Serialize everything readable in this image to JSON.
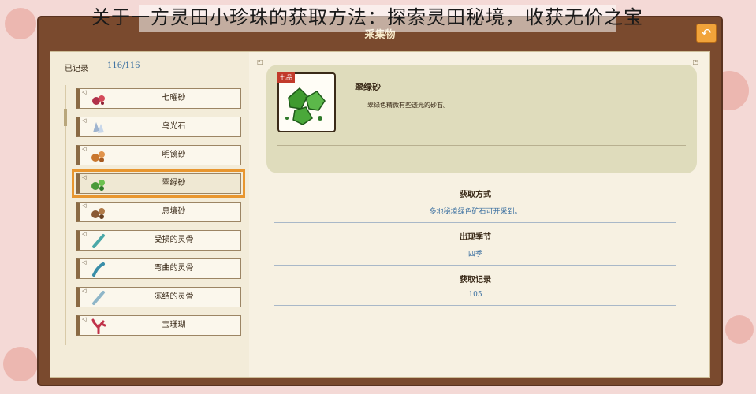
{
  "banner": {
    "text": "关于一方灵田小珍珠的获取方法：探索灵田秘境，收获无价之宝"
  },
  "window": {
    "title": "采集物",
    "back_icon": "back-arrow-icon"
  },
  "list": {
    "recorded_label": "已记录",
    "recorded_count": "116/116",
    "items": [
      {
        "label": "七曜砂",
        "icon": "red-sand-icon"
      },
      {
        "label": "乌光石",
        "icon": "crystal-stone-icon"
      },
      {
        "label": "明镜砂",
        "icon": "orange-sand-icon"
      },
      {
        "label": "翠绿砂",
        "icon": "green-sand-icon",
        "selected": true
      },
      {
        "label": "息壤砂",
        "icon": "brown-sand-icon"
      },
      {
        "label": "受损的灵骨",
        "icon": "bone-icon"
      },
      {
        "label": "弯曲的灵骨",
        "icon": "bone-icon"
      },
      {
        "label": "冻结的灵骨",
        "icon": "bone-icon"
      },
      {
        "label": "宝珊瑚",
        "icon": "coral-icon"
      }
    ]
  },
  "detail": {
    "rarity": "七品",
    "name": "翠绿砂",
    "description": "翠绿色精微有些透光的砂石。",
    "sections": [
      {
        "heading": "获取方式",
        "value": "多地秘境绿色矿石可开采到。"
      },
      {
        "heading": "出现季节",
        "value": "四季"
      },
      {
        "heading": "获取记录",
        "value": "105"
      }
    ]
  },
  "colors": {
    "frame": "#7a4a2e",
    "accent": "#e8962f",
    "value_text": "#3a6fa0"
  }
}
